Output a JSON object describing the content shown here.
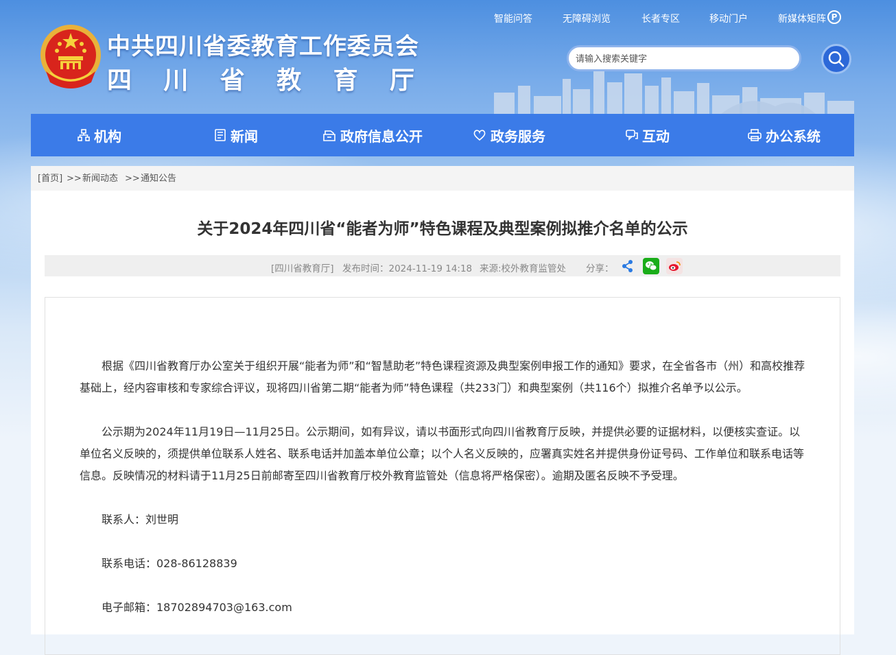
{
  "header": {
    "org_name": "中共四川省委教育工作委员会",
    "dept_chars": [
      "四",
      "川",
      "省",
      "教",
      "育",
      "厅"
    ],
    "top_links": [
      "智能问答",
      "无障碍浏览",
      "长者专区",
      "移动门户",
      "新媒体矩阵"
    ],
    "search_placeholder": "请输入搜索关键字"
  },
  "nav": [
    {
      "label": "机构",
      "icon": "org-chart-icon"
    },
    {
      "label": "新闻",
      "icon": "news-icon"
    },
    {
      "label": "政府信息公开",
      "icon": "info-disclosure-icon"
    },
    {
      "label": "政务服务",
      "icon": "service-heart-icon"
    },
    {
      "label": "互动",
      "icon": "interaction-icon"
    },
    {
      "label": "办公系统",
      "icon": "printer-icon"
    }
  ],
  "breadcrumb": [
    "[首页]",
    ">>",
    "新闻动态",
    ">>",
    "通知公告"
  ],
  "article": {
    "title": "关于2024年四川省“能者为师”特色课程及典型案例拟推介名单的公示",
    "source_tag": "[四川省教育厅]",
    "publish_time": "发布时间：2024-11-19 14:18",
    "origin": "来源:校外教育监管处",
    "share_label": "分享："
  },
  "paragraphs": [
    "根据《四川省教育厅办公室关于组织开展“能者为师”和“智慧助老”特色课程资源及典型案例申报工作的通知》要求，在全省各市（州）和高校推荐基础上，经内容审核和专家综合评议，现将四川省第二期“能者为师”特色课程（共233门）和典型案例（共116个）拟推介名单予以公示。",
    "公示期为2024年11月19日—11月25日。公示期间，如有异议，请以书面形式向四川省教育厅反映，并提供必要的证据材料，以便核实查证。以单位名义反映的，须提供单位联系人姓名、联系电话并加盖本单位公章；以个人名义反映的，应署真实姓名并提供身份证号码、工作单位和联系电话等信息。反映情况的材料请于11月25日前邮寄至四川省教育厅校外教育监管处（信息将严格保密）。逾期及匿名反映不予受理。",
    "联系人：刘世明",
    "联系电话：028-86128839",
    "电子邮箱：18702894703@163.com"
  ],
  "colors": {
    "nav_bg": "#3b7be8",
    "wechat": "#1aad19",
    "weibo": "#e6162d",
    "share": "#2a7ae2"
  }
}
